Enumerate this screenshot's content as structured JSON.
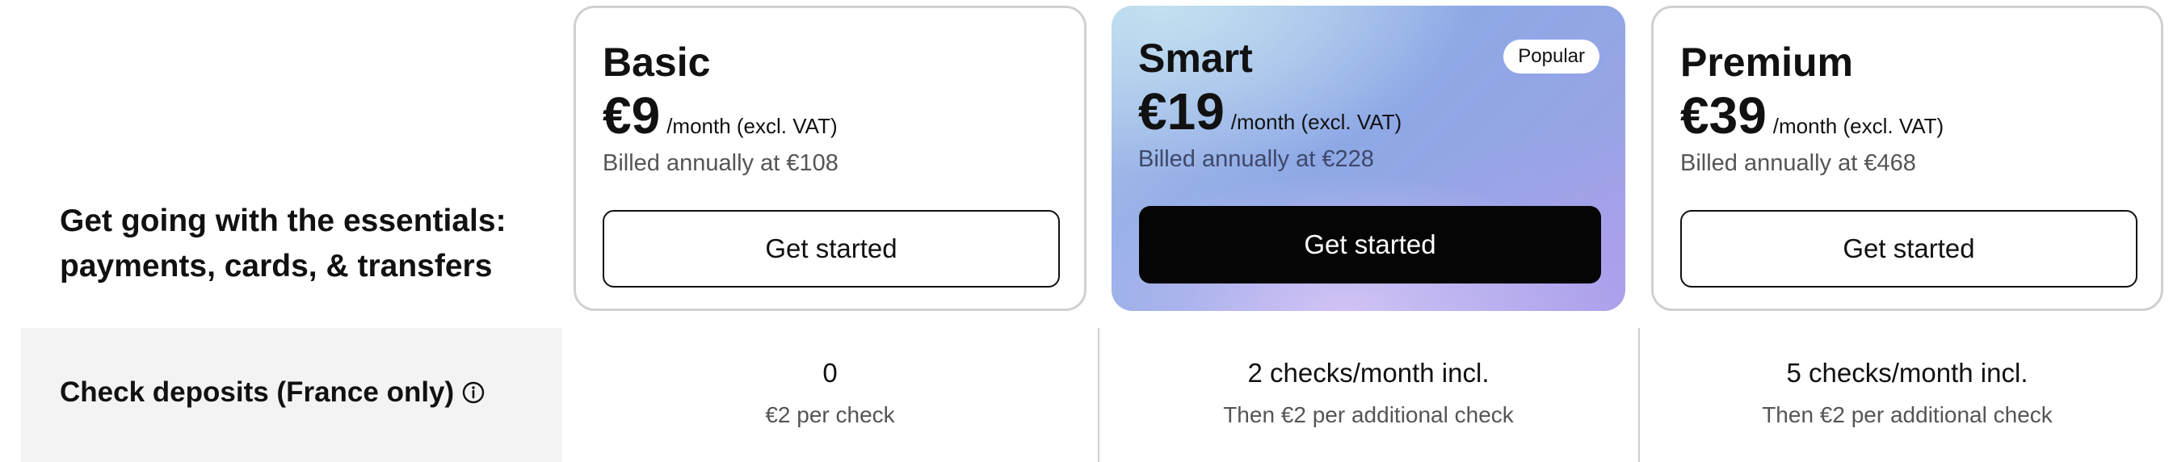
{
  "intro": {
    "line1": "Get going with the essentials:",
    "line2": "payments, cards, & transfers"
  },
  "plans": [
    {
      "name": "Basic",
      "price": "€9",
      "price_unit": "/month (excl. VAT)",
      "billed": "Billed annually at €108",
      "cta": "Get started",
      "cta_style": "outline"
    },
    {
      "name": "Smart",
      "badge": "Popular",
      "price": "€19",
      "price_unit": "/month (excl. VAT)",
      "billed": "Billed annually at €228",
      "cta": "Get started",
      "cta_style": "filled"
    },
    {
      "name": "Premium",
      "price": "€39",
      "price_unit": "/month (excl. VAT)",
      "billed": "Billed annually at €468",
      "cta": "Get started",
      "cta_style": "outline"
    }
  ],
  "features": [
    {
      "label": "Check deposits (France only)",
      "info_icon": "info-circle-icon",
      "values": [
        {
          "main": "0",
          "sub": "€2 per check"
        },
        {
          "main": "2 checks/month incl.",
          "sub": "Then €2 per additional check"
        },
        {
          "main": "5 checks/month incl.",
          "sub": "Then €2 per additional check"
        }
      ]
    }
  ],
  "colors": {
    "text": "#111111",
    "muted_text": "#555555",
    "card_border": "#d0d0d0",
    "cta_filled_bg": "#050505",
    "feature_label_bg": "#f3f3f3",
    "smart_gradient": [
      "#a9c3ea",
      "#8ea8e6",
      "#ad9ee8"
    ]
  }
}
